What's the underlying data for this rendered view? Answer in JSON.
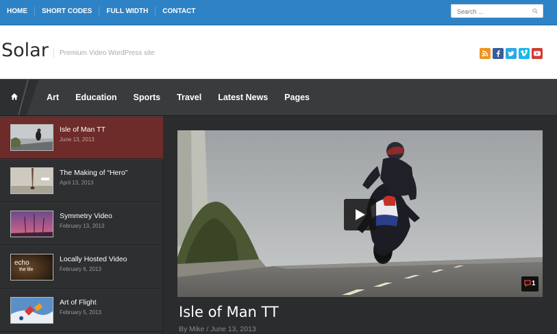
{
  "topbar": {
    "links": [
      "HOME",
      "SHORT CODES",
      "FULL WIDTH",
      "CONTACT"
    ],
    "search_placeholder": "Search ...",
    "bg_color": "#2e83c6"
  },
  "header": {
    "logo": "Solar",
    "tagline": "Premium Video WordPress site",
    "social": [
      {
        "icon": "rss-icon",
        "color": "#f0941d"
      },
      {
        "icon": "facebook-icon",
        "color": "#3b5b9a"
      },
      {
        "icon": "twitter-icon",
        "color": "#2aa9e0"
      },
      {
        "icon": "vimeo-icon",
        "color": "#1ab7ea"
      },
      {
        "icon": "youtube-icon",
        "color": "#d33b34"
      }
    ]
  },
  "mainnav": {
    "home_icon": "home-icon",
    "items": [
      "Art",
      "Education",
      "Sports",
      "Travel",
      "Latest News",
      "Pages"
    ]
  },
  "sidebar": {
    "items": [
      {
        "title": "Isle of Man TT",
        "date": "June 13, 2013",
        "active": true
      },
      {
        "title": "The Making of “Hero”",
        "date": "April 13, 2013",
        "active": false
      },
      {
        "title": "Symmetry Video",
        "date": "February 13, 2013",
        "active": false
      },
      {
        "title": "Locally Hosted Video",
        "date": "February 6, 2013",
        "active": false
      },
      {
        "title": "Art of Flight",
        "date": "February 5, 2013",
        "active": false
      }
    ],
    "active_color": "#6d2b29"
  },
  "video": {
    "title": "Isle of Man TT",
    "meta_by": "By",
    "author": "Mike",
    "meta_sep": " / ",
    "date": "June 13, 2013",
    "comment_count": "1",
    "thumb_text_line1": "echo",
    "thumb_text_line2": "the life"
  }
}
